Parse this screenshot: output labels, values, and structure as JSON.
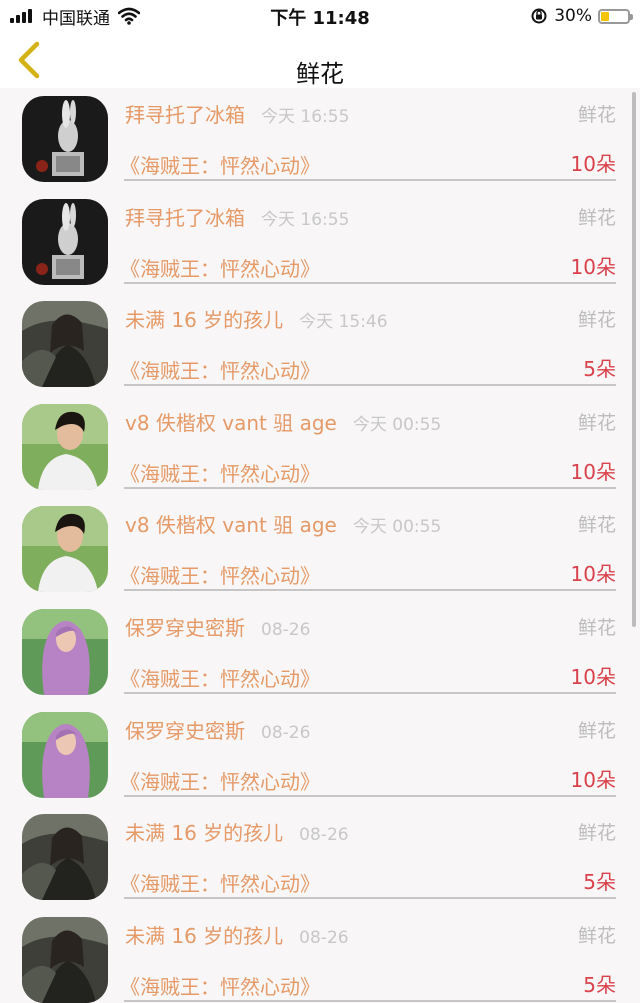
{
  "status_bar": {
    "carrier": "中国联通",
    "time": "下午 11:48",
    "battery_percent": "30%",
    "battery_level": 0.3,
    "battery_color": "#f5c400"
  },
  "nav": {
    "back_icon": "chevron-left-icon",
    "title": "鲜花"
  },
  "colors": {
    "sender": "#e59a68",
    "time": "#c8c8c8",
    "amount": "#d9424c",
    "back_icon": "#d4b215"
  },
  "gifts": [
    {
      "avatar": "rabbit-statue",
      "name": "拜寻托了冰箱",
      "time": "今天 16:55",
      "type": "鲜花",
      "book": "《海贼王：怦然心动》",
      "amount": "10朵"
    },
    {
      "avatar": "rabbit-statue",
      "name": "拜寻托了冰箱",
      "time": "今天 16:55",
      "type": "鲜花",
      "book": "《海贼王：怦然心动》",
      "amount": "10朵"
    },
    {
      "avatar": "dark-figure",
      "name": "未满 16 岁的孩儿",
      "time": "今天 15:46",
      "type": "鲜花",
      "book": "《海贼王：怦然心动》",
      "amount": "5朵"
    },
    {
      "avatar": "young-man",
      "name": "v8 佚楷权 vant 驵 age",
      "time": "今天 00:55",
      "type": "鲜花",
      "book": "《海贼王：怦然心动》",
      "amount": "10朵"
    },
    {
      "avatar": "young-man",
      "name": "v8 佚楷权 vant 驵 age",
      "time": "今天 00:55",
      "type": "鲜花",
      "book": "《海贼王：怦然心动》",
      "amount": "10朵"
    },
    {
      "avatar": "purple-hair-girl",
      "name": "保罗穿史密斯",
      "time": "08-26",
      "type": "鲜花",
      "book": "《海贼王：怦然心动》",
      "amount": "10朵"
    },
    {
      "avatar": "purple-hair-girl",
      "name": "保罗穿史密斯",
      "time": "08-26",
      "type": "鲜花",
      "book": "《海贼王：怦然心动》",
      "amount": "10朵"
    },
    {
      "avatar": "dark-figure",
      "name": "未满 16 岁的孩儿",
      "time": "08-26",
      "type": "鲜花",
      "book": "《海贼王：怦然心动》",
      "amount": "5朵"
    },
    {
      "avatar": "dark-figure",
      "name": "未满 16 岁的孩儿",
      "time": "08-26",
      "type": "鲜花",
      "book": "《海贼王：怦然心动》",
      "amount": "5朵"
    }
  ]
}
